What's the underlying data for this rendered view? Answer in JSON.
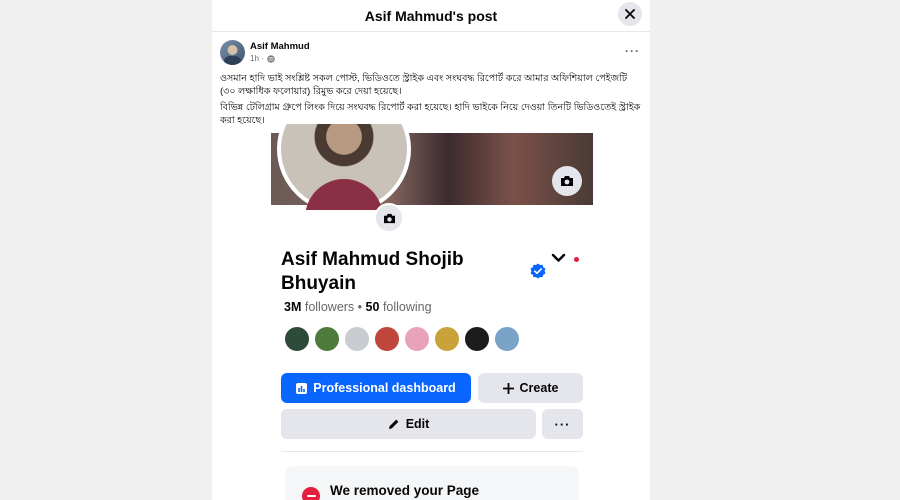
{
  "dialog": {
    "title": "Asif Mahmud's post",
    "close_icon": "close-icon"
  },
  "post": {
    "author": "Asif Mahmud",
    "time": "1h ·",
    "privacy_icon": "globe-icon",
    "more_icon": "more-horizontal-icon",
    "paragraphs": [
      "ওসমান হাদি ভাই সংশ্লিষ্ট সকল পোস্ট, ভিডিওতে স্ট্রাইক এবং সংঘবদ্ধ রিপোর্ট করে আমার অফিশিয়াল পেইজটি (৩০ লক্ষাধিক ফলোয়ার) রিমুভ করে দেয়া হয়েছে।",
      "বিভিন্ন টেলিগ্রাম গ্রুপে লিংক দিয়ে সংঘবদ্ধ রিপোর্ট করা হয়েছে। হাদি ভাইকে নিয়ে দেওয়া তিনটি ভিডিওতেই স্ট্রাইক করা হয়েছে।"
    ]
  },
  "profile": {
    "name": "Asif Mahmud Shojib Bhuyain",
    "verified_icon": "verified-badge-icon",
    "followers_count": "3M",
    "followers_label": "followers",
    "separator": "•",
    "following_count": "50",
    "following_label": "following",
    "friends": [
      {
        "color": "#2d4a3a"
      },
      {
        "color": "#4e7a3c"
      },
      {
        "color": "#c9ccd1"
      },
      {
        "color": "#c0473c"
      },
      {
        "color": "#e8a3b8"
      },
      {
        "color": "#c9a23a"
      },
      {
        "color": "#1c1c1c"
      },
      {
        "color": "#7aa3c8"
      }
    ]
  },
  "actions": {
    "professional_dashboard": "Professional dashboard",
    "create": "Create",
    "edit": "Edit",
    "more": "···"
  },
  "notice": {
    "title": "We removed your Page"
  },
  "colors": {
    "primary": "#0866ff",
    "verified": "#0866ff",
    "danger": "#e41e3f"
  }
}
